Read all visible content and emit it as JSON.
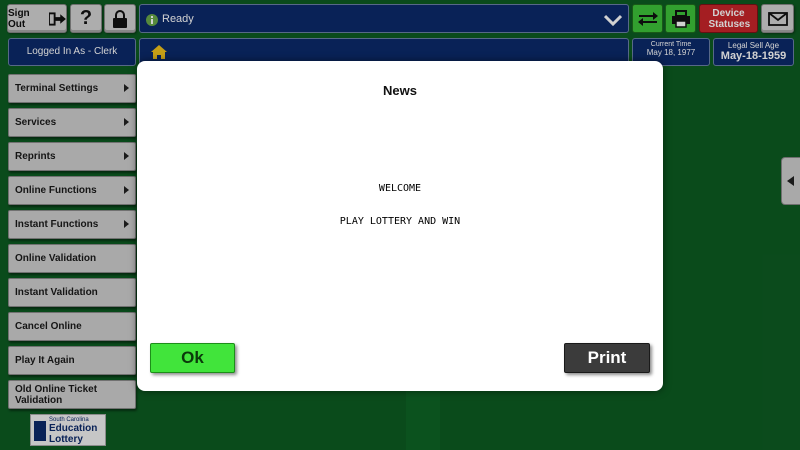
{
  "colors": {
    "background": "#0d5c22",
    "navy": "#0c2a6b",
    "ok_green": "#41e43b",
    "red": "#c9252a",
    "print_dark": "#3b3b3b"
  },
  "topbar": {
    "sign_out_label": "Sign Out",
    "help_label": "?",
    "status_text": "Ready",
    "device_statuses_label": "Device Statuses",
    "logged_in_label": "Logged In As - Clerk",
    "current_time_label": "Current Time",
    "current_time_value": "May 18, 1977",
    "legal_sell_age_label": "Legal Sell Age",
    "legal_sell_age_value": "May-18-1959"
  },
  "icons": {
    "sign_out": "exit-arrow-icon",
    "lock": "lock-icon",
    "info": "info-icon",
    "dropdown": "chevron-down-icon",
    "transfer": "swap-arrows-icon",
    "printer": "printer-icon",
    "mail": "envelope-icon",
    "home": "home-icon"
  },
  "sidebar": {
    "items": [
      {
        "label": "Terminal Settings",
        "submenu": true
      },
      {
        "label": "Services",
        "submenu": true
      },
      {
        "label": "Reprints",
        "submenu": true
      },
      {
        "label": "Online Functions",
        "submenu": true
      },
      {
        "label": "Instant Functions",
        "submenu": true
      },
      {
        "label": "Online Validation",
        "submenu": false
      },
      {
        "label": "Instant Validation",
        "submenu": false
      },
      {
        "label": "Cancel Online",
        "submenu": false
      },
      {
        "label": "Play It Again",
        "submenu": false
      },
      {
        "label": "Old Online Ticket Validation",
        "submenu": false
      }
    ]
  },
  "logo": {
    "line1": "South Carolina",
    "line2": "Education",
    "line3": "Lottery"
  },
  "modal": {
    "title": "News",
    "lines": [
      "WELCOME",
      "PLAY LOTTERY AND WIN"
    ],
    "ok_label": "Ok",
    "print_label": "Print"
  }
}
